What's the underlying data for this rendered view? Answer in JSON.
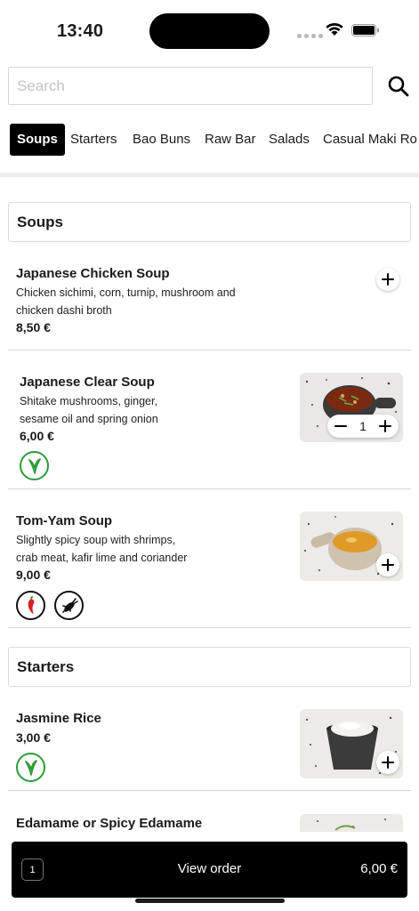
{
  "status": {
    "time": "13:40"
  },
  "search": {
    "placeholder": "Search"
  },
  "categories": [
    "Soups",
    "Starters",
    "Bao Buns",
    "Raw Bar",
    "Salads",
    "Casual Maki Ro"
  ],
  "active_category": "Soups",
  "sections": {
    "soups": "Soups",
    "starters": "Starters"
  },
  "items": [
    {
      "name": "Japanese Chicken Soup",
      "description": "Chicken sichimi, corn, turnip, mushroom and chicken dashi broth",
      "price": "8,50 €",
      "badges": []
    },
    {
      "name": "Japanese Clear Soup",
      "description": "Shitake mushrooms, ginger, sesame oil and spring onion",
      "price": "6,00 €",
      "quantity": "1",
      "badges": [
        "vegan-leaf-icon"
      ]
    },
    {
      "name": "Tom-Yam Soup",
      "description": "Slightly spicy soup with shrimps, crab meat, kafir lime and coriander",
      "price": "9,00 €",
      "badges": [
        "chili-icon",
        "shellfish-icon"
      ]
    },
    {
      "name": "Jasmine Rice",
      "price": "3,00 €",
      "badges": [
        "vegan-leaf-icon"
      ]
    },
    {
      "name": "Edamame or Spicy Edamame"
    }
  ],
  "order_bar": {
    "count": "1",
    "label": "View order",
    "total": "6,00 €"
  },
  "colors": {
    "accent": "#000000",
    "vegan": "#2e9b3a",
    "chili": "#d42020"
  }
}
